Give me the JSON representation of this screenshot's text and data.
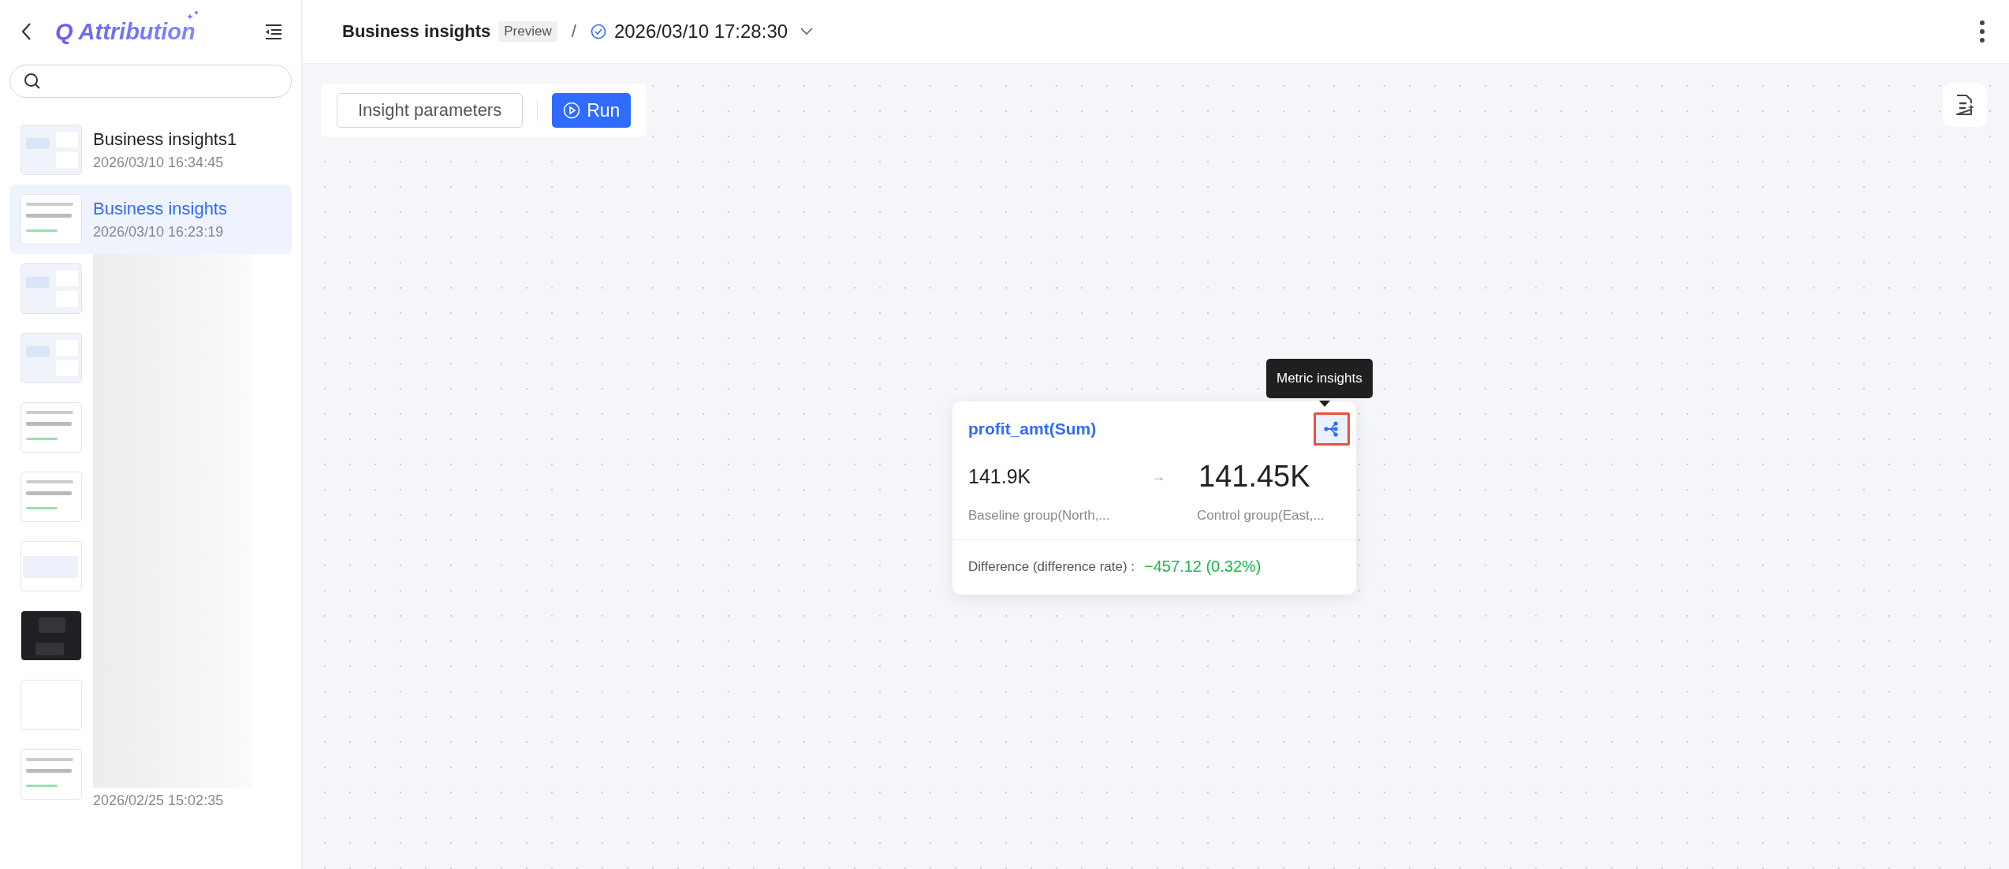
{
  "sidebar": {
    "logo": "Q Attribution",
    "items": [
      {
        "title": "Business insights1",
        "date": "2026/03/10 16:34:45",
        "selected": false,
        "blurred": false,
        "kind": "canvas"
      },
      {
        "title": "Business insights",
        "date": "2026/03/10 16:23:19",
        "selected": true,
        "blurred": false,
        "kind": "card"
      },
      {
        "selected": false,
        "blurred": true,
        "kind": "canvas"
      },
      {
        "selected": false,
        "blurred": true,
        "kind": "canvas"
      },
      {
        "selected": false,
        "blurred": true,
        "kind": "card"
      },
      {
        "selected": false,
        "blurred": true,
        "kind": "card"
      },
      {
        "selected": false,
        "blurred": true,
        "kind": "empty"
      },
      {
        "selected": false,
        "blurred": true,
        "kind": "dark"
      },
      {
        "selected": false,
        "blurred": true,
        "kind": "blank"
      },
      {
        "date": "2026/02/25 15:02:35",
        "selected": false,
        "blurred": true,
        "kind": "card"
      }
    ]
  },
  "header": {
    "title": "Business insights",
    "badge": "Preview",
    "separator": "/",
    "version": "2026/03/10 17:28:30"
  },
  "toolbar": {
    "buttons": [
      "Insight parameters",
      "Run"
    ]
  },
  "card": {
    "title": "profit_amt(Sum)",
    "tooltip": "Metric insights",
    "icon_highlighted": true,
    "baseline_value": "141.9K",
    "arrow": "→",
    "control_value": "141.45K",
    "baseline_label": "Baseline group(North,...",
    "control_label": "Control group(East,...",
    "difference_label": "Difference (difference rate) :",
    "difference_value": "−457.12 (0.32%)"
  }
}
